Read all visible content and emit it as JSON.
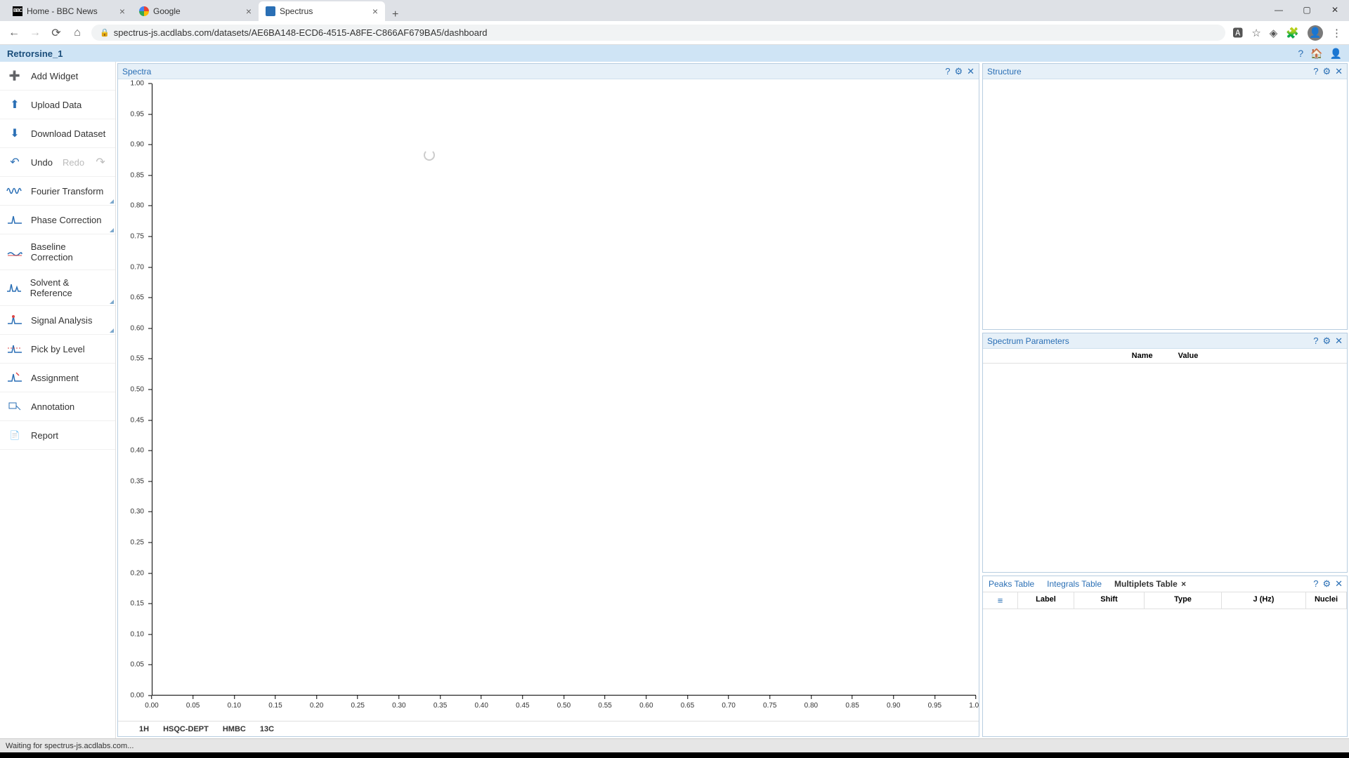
{
  "browser": {
    "tabs": [
      {
        "title": "Home - BBC News",
        "fav": "bbc",
        "active": false
      },
      {
        "title": "Google",
        "fav": "google",
        "active": false
      },
      {
        "title": "Spectrus",
        "fav": "spectrus",
        "active": true
      }
    ],
    "url": "spectrus-js.acdlabs.com/datasets/AE6BA148-ECD6-4515-A8FE-C866AF679BA5/dashboard",
    "win": {
      "min": "—",
      "max": "▢",
      "close": "✕"
    }
  },
  "app": {
    "title": "Retrorsine_1"
  },
  "sidebar": {
    "items": [
      {
        "label": "Add Widget"
      },
      {
        "label": "Upload Data"
      },
      {
        "label": "Download Dataset"
      },
      {
        "label": "Undo",
        "secondary": "Redo"
      },
      {
        "label": "Fourier Transform"
      },
      {
        "label": "Phase Correction"
      },
      {
        "label": "Baseline Correction"
      },
      {
        "label": "Solvent & Reference"
      },
      {
        "label": "Signal Analysis"
      },
      {
        "label": "Pick by Level"
      },
      {
        "label": "Assignment"
      },
      {
        "label": "Annotation"
      },
      {
        "label": "Report"
      }
    ]
  },
  "spectra": {
    "title": "Spectra",
    "tabs": [
      "1H",
      "HSQC-DEPT",
      "HMBC",
      "13C"
    ]
  },
  "structure": {
    "title": "Structure"
  },
  "params": {
    "title": "Spectrum Parameters",
    "cols": {
      "name": "Name",
      "value": "Value"
    }
  },
  "tables": {
    "tabs": [
      {
        "label": "Peaks Table",
        "active": false
      },
      {
        "label": "Integrals Table",
        "active": false
      },
      {
        "label": "Multiplets Table",
        "active": true
      }
    ],
    "cols": {
      "label": "Label",
      "shift": "Shift",
      "type": "Type",
      "jhz": "J (Hz)",
      "nuclei": "Nuclei"
    }
  },
  "status": "Waiting for spectrus-js.acdlabs.com...",
  "chart_data": {
    "type": "line",
    "title": "",
    "xlabel": "",
    "ylabel": "",
    "xlim": [
      0.0,
      1.0
    ],
    "ylim": [
      0.0,
      1.0
    ],
    "x_ticks": [
      0.0,
      0.05,
      0.1,
      0.15,
      0.2,
      0.25,
      0.3,
      0.35,
      0.4,
      0.45,
      0.5,
      0.55,
      0.6,
      0.65,
      0.7,
      0.75,
      0.8,
      0.85,
      0.9,
      0.95,
      1.0
    ],
    "y_ticks": [
      0.0,
      0.05,
      0.1,
      0.15,
      0.2,
      0.25,
      0.3,
      0.35,
      0.4,
      0.45,
      0.5,
      0.55,
      0.6,
      0.65,
      0.7,
      0.75,
      0.8,
      0.85,
      0.9,
      0.95,
      1.0
    ],
    "series": []
  }
}
